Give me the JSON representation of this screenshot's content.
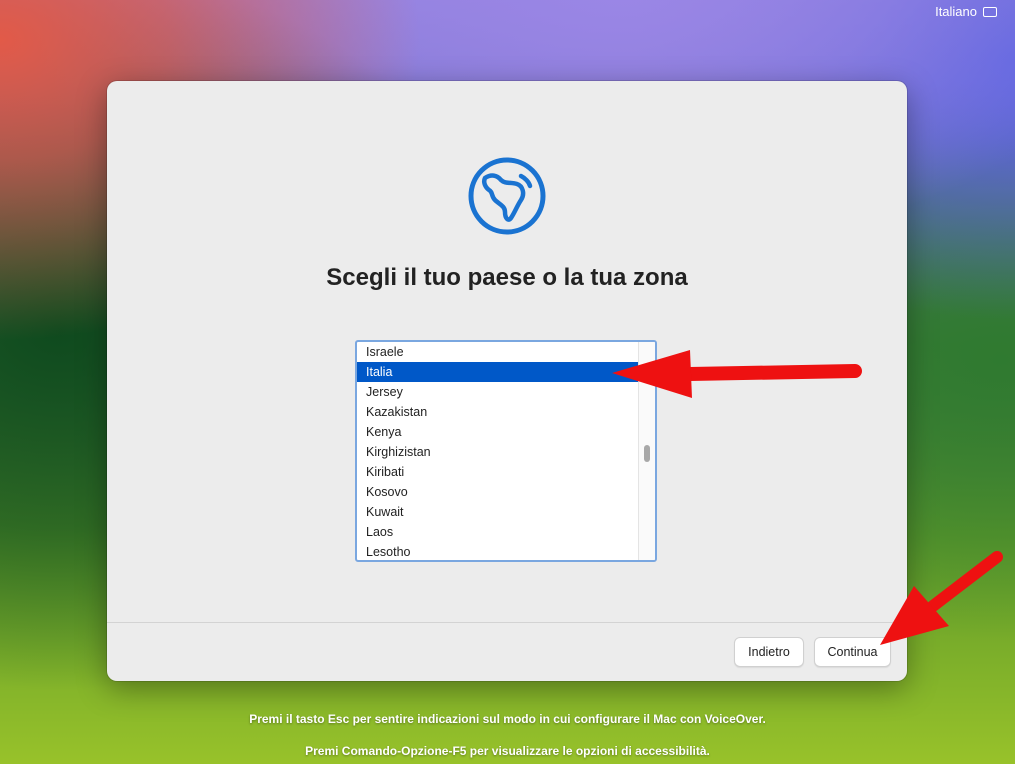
{
  "menubar": {
    "input_language": "Italiano",
    "keyboard_icon": "keyboard-icon"
  },
  "setup": {
    "icon": "globe-icon",
    "title": "Scegli il tuo paese o la tua zona",
    "countries": [
      "Israele",
      "Italia",
      "Jersey",
      "Kazakistan",
      "Kenya",
      "Kirghizistan",
      "Kiribati",
      "Kosovo",
      "Kuwait",
      "Laos",
      "Lesotho"
    ],
    "selected": "Italia",
    "back_label": "Indietro",
    "continue_label": "Continua"
  },
  "footer": {
    "voiceover_hint": "Premi il tasto Esc per sentire indicazioni sul modo in cui configurare il Mac con VoiceOver.",
    "accessibility_hint": "Premi Comando-Opzione-F5 per visualizzare le opzioni di accessibilità."
  },
  "colors": {
    "accent": "#0058c8",
    "arrow": "#ee1111",
    "globe": "#1a73d1"
  }
}
